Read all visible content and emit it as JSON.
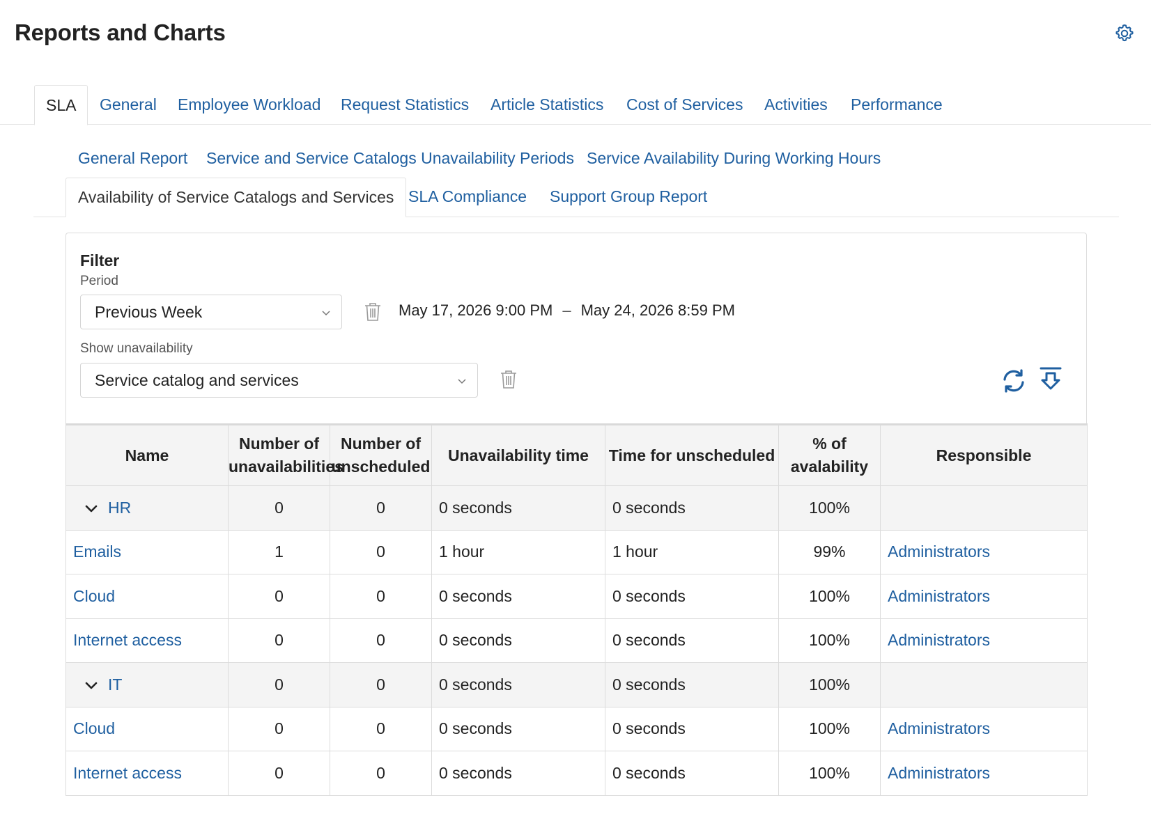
{
  "page": {
    "title": "Reports and Charts"
  },
  "icons": {
    "settings": "gear-icon",
    "trash": "trash-icon",
    "refresh": "refresh-icon",
    "export": "download-icon",
    "chevron": "chevron-down-icon"
  },
  "colors": {
    "link": "#1f5fa0",
    "header_bg": "#f4f4f4",
    "border": "#dcdcdc"
  },
  "main_tabs": [
    {
      "label": "SLA",
      "active": true
    },
    {
      "label": "General"
    },
    {
      "label": "Employee Workload"
    },
    {
      "label": "Request Statistics"
    },
    {
      "label": "Article Statistics"
    },
    {
      "label": "Cost of Services"
    },
    {
      "label": "Activities"
    },
    {
      "label": "Performance"
    }
  ],
  "sub_tabs": [
    {
      "label": "General Report"
    },
    {
      "label": "Service and Service Catalogs Unavailability Periods"
    },
    {
      "label": "Service Availability During Working Hours"
    },
    {
      "label": "Availability of Service Catalogs and Services",
      "active": true
    },
    {
      "label": "SLA Compliance"
    },
    {
      "label": "Support Group Report"
    }
  ],
  "filter": {
    "title": "Filter",
    "period_label": "Period",
    "period_value": "Previous Week",
    "date_from": "May 17, 2026 9:00 PM",
    "date_separator": "–",
    "date_to": "May 24, 2026 8:59 PM",
    "unavailability_label": "Show unavailability",
    "unavailability_value": "Service catalog and services"
  },
  "table": {
    "headers": {
      "name": "Name",
      "num_unavail": [
        "Number of",
        "unavailabilities"
      ],
      "num_unsched": [
        "Number of",
        "unscheduled"
      ],
      "unavail_time": "Unavailability time",
      "unsched_time": "Time for unscheduled",
      "pct": [
        "% of",
        "avalability"
      ],
      "responsible": "Responsible"
    },
    "rows": [
      {
        "group": true,
        "name": "HR",
        "num_unavail": "0",
        "num_unsched": "0",
        "unavail_time": "0 seconds",
        "unsched_time": "0 seconds",
        "pct": "100%",
        "responsible": ""
      },
      {
        "group": false,
        "name": "Emails",
        "num_unavail": "1",
        "num_unsched": "0",
        "unavail_time": "1 hour",
        "unsched_time": "1 hour",
        "pct": "99%",
        "responsible": "Administrators"
      },
      {
        "group": false,
        "name": "Cloud",
        "num_unavail": "0",
        "num_unsched": "0",
        "unavail_time": "0 seconds",
        "unsched_time": "0 seconds",
        "pct": "100%",
        "responsible": "Administrators"
      },
      {
        "group": false,
        "name": "Internet access",
        "num_unavail": "0",
        "num_unsched": "0",
        "unavail_time": "0 seconds",
        "unsched_time": "0 seconds",
        "pct": "100%",
        "responsible": "Administrators"
      },
      {
        "group": true,
        "name": "IT",
        "num_unavail": "0",
        "num_unsched": "0",
        "unavail_time": "0 seconds",
        "unsched_time": "0 seconds",
        "pct": "100%",
        "responsible": ""
      },
      {
        "group": false,
        "name": "Cloud",
        "num_unavail": "0",
        "num_unsched": "0",
        "unavail_time": "0 seconds",
        "unsched_time": "0 seconds",
        "pct": "100%",
        "responsible": "Administrators"
      },
      {
        "group": false,
        "name": "Internet access",
        "num_unavail": "0",
        "num_unsched": "0",
        "unavail_time": "0 seconds",
        "unsched_time": "0 seconds",
        "pct": "100%",
        "responsible": "Administrators"
      }
    ]
  }
}
